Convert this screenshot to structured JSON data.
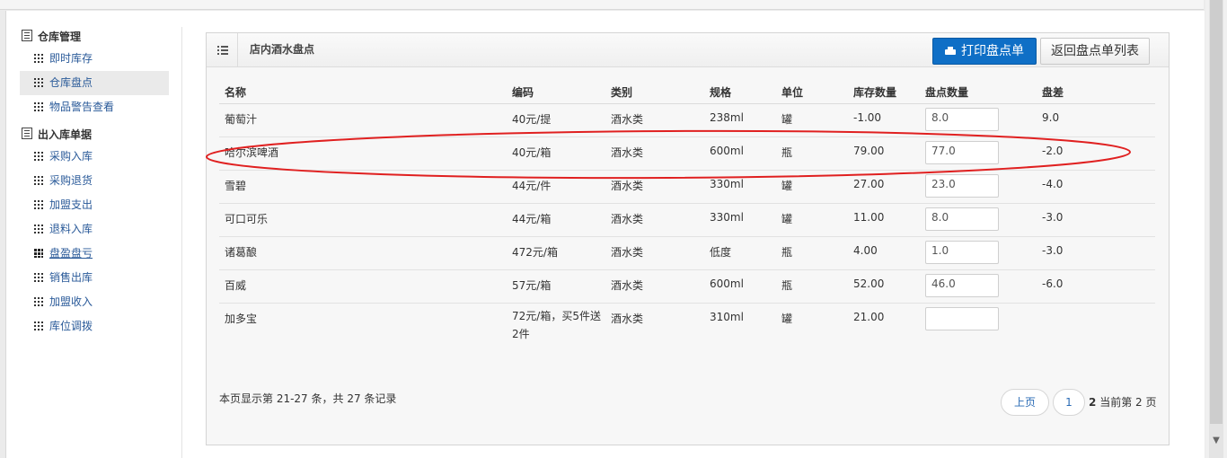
{
  "sidebar": {
    "groups": [
      {
        "title": "仓库管理",
        "items": [
          {
            "label": "即时库存"
          },
          {
            "label": "仓库盘点"
          },
          {
            "label": "物品警告查看"
          }
        ]
      },
      {
        "title": "出入库单据",
        "items": [
          {
            "label": "采购入库"
          },
          {
            "label": "采购退货"
          },
          {
            "label": "加盟支出"
          },
          {
            "label": "退料入库"
          },
          {
            "label": "盘盈盘亏"
          },
          {
            "label": "销售出库"
          },
          {
            "label": "加盟收入"
          },
          {
            "label": "库位调拨"
          }
        ]
      }
    ]
  },
  "panel": {
    "title": "店内酒水盘点",
    "print_label": "打印盘点单",
    "back_label": "返回盘点单列表"
  },
  "table": {
    "columns": [
      "名称",
      "编码",
      "类别",
      "规格",
      "单位",
      "库存数量",
      "盘点数量",
      "盘差"
    ],
    "rows": [
      {
        "name": "葡萄汁",
        "code": "40元/提",
        "category": "酒水类",
        "spec": "238ml",
        "unit": "罐",
        "stock": "-1.00",
        "count": "8.0",
        "diff": "9.0"
      },
      {
        "name": "哈尔滨啤酒",
        "code": "40元/箱",
        "category": "酒水类",
        "spec": "600ml",
        "unit": "瓶",
        "stock": "79.00",
        "count": "77.0",
        "diff": "-2.0"
      },
      {
        "name": "雪碧",
        "code": "44元/件",
        "category": "酒水类",
        "spec": "330ml",
        "unit": "罐",
        "stock": "27.00",
        "count": "23.0",
        "diff": "-4.0"
      },
      {
        "name": "可口可乐",
        "code": "44元/箱",
        "category": "酒水类",
        "spec": "330ml",
        "unit": "罐",
        "stock": "11.00",
        "count": "8.0",
        "diff": "-3.0"
      },
      {
        "name": "诸葛酿",
        "code": "472元/箱",
        "category": "酒水类",
        "spec": "低度",
        "unit": "瓶",
        "stock": "4.00",
        "count": "1.0",
        "diff": "-3.0"
      },
      {
        "name": "百威",
        "code": "57元/箱",
        "category": "酒水类",
        "spec": "600ml",
        "unit": "瓶",
        "stock": "52.00",
        "count": "46.0",
        "diff": "-6.0"
      },
      {
        "name": "加多宝",
        "code": "72元/箱，买5件送2件",
        "category": "酒水类",
        "spec": "310ml",
        "unit": "罐",
        "stock": "21.00",
        "count": "",
        "diff": ""
      }
    ]
  },
  "footer": {
    "record_info": "本页显示第 21-27 条，共 27 条记录",
    "prev_label": "上页",
    "page_one": "1",
    "current_page": "2",
    "current_text": "当前第 2 页"
  },
  "colors": {
    "accent": "#0f6fc6",
    "annotation": "#e02020"
  }
}
